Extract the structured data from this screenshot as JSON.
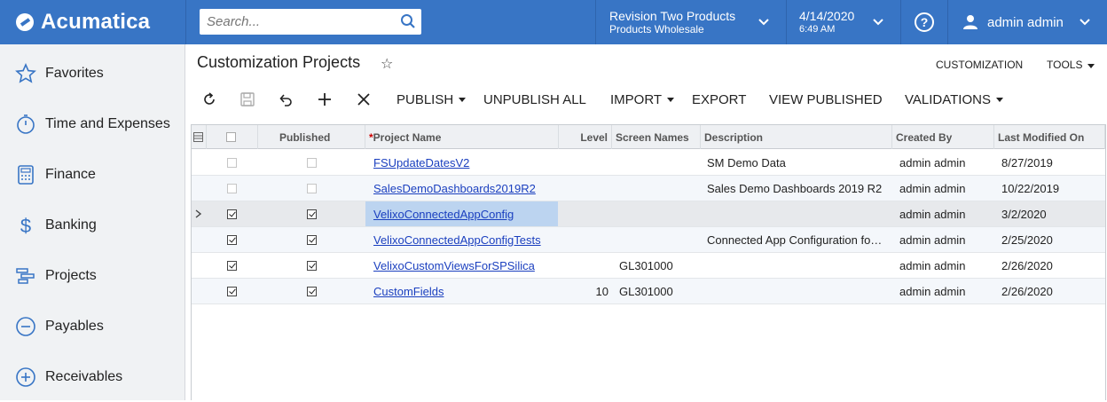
{
  "topbar": {
    "logo": "Acumatica",
    "search_placeholder": "Search...",
    "company_line1": "Revision Two Products",
    "company_line2": "Products Wholesale",
    "date": "4/14/2020",
    "time": "6:49 AM",
    "help": "?",
    "user": "admin admin",
    "accent": "#3875c5"
  },
  "sidebar": {
    "items": [
      {
        "label": "Favorites",
        "icon": "star-icon"
      },
      {
        "label": "Time and Expenses",
        "icon": "stopwatch-icon"
      },
      {
        "label": "Finance",
        "icon": "calculator-icon"
      },
      {
        "label": "Banking",
        "icon": "dollar-icon"
      },
      {
        "label": "Projects",
        "icon": "gantt-icon"
      },
      {
        "label": "Payables",
        "icon": "minus-circle-icon"
      },
      {
        "label": "Receivables",
        "icon": "plus-circle-icon"
      }
    ]
  },
  "page": {
    "title": "Customization Projects",
    "customization_link": "CUSTOMIZATION",
    "tools_link": "TOOLS"
  },
  "toolbar": {
    "publish": "PUBLISH",
    "unpublish_all": "UNPUBLISH ALL",
    "import": "IMPORT",
    "export": "EXPORT",
    "view_published": "VIEW PUBLISHED",
    "validations": "VALIDATIONS"
  },
  "grid": {
    "columns": {
      "published": "Published",
      "project_name": "Project Name",
      "level": "Level",
      "screen_names": "Screen Names",
      "description": "Description",
      "created_by": "Created By",
      "last_modified_on": "Last Modified On"
    },
    "rows": [
      {
        "selected": false,
        "published": false,
        "name": "FSUpdateDatesV2",
        "level": "",
        "screens": "",
        "description": "SM Demo Data",
        "created_by": "admin admin",
        "modified": "8/27/2019"
      },
      {
        "selected": false,
        "published": false,
        "name": "SalesDemoDashboards2019R2",
        "level": "",
        "screens": "",
        "description": "Sales Demo Dashboards 2019 R2",
        "created_by": "admin admin",
        "modified": "10/22/2019"
      },
      {
        "selected": true,
        "published": true,
        "name": "VelixoConnectedAppConfig",
        "level": "",
        "screens": "",
        "description": "",
        "created_by": "admin admin",
        "modified": "3/2/2020"
      },
      {
        "selected": true,
        "published": true,
        "name": "VelixoConnectedAppConfigTests",
        "level": "",
        "screens": "",
        "description": "Connected App Configuration fo…",
        "created_by": "admin admin",
        "modified": "2/25/2020"
      },
      {
        "selected": true,
        "published": true,
        "name": "VelixoCustomViewsForSPSilica",
        "level": "",
        "screens": "GL301000",
        "description": "",
        "created_by": "admin admin",
        "modified": "2/26/2020"
      },
      {
        "selected": true,
        "published": true,
        "name": "CustomFields",
        "level": "10",
        "screens": "GL301000",
        "description": "",
        "created_by": "admin admin",
        "modified": "2/26/2020"
      }
    ]
  }
}
